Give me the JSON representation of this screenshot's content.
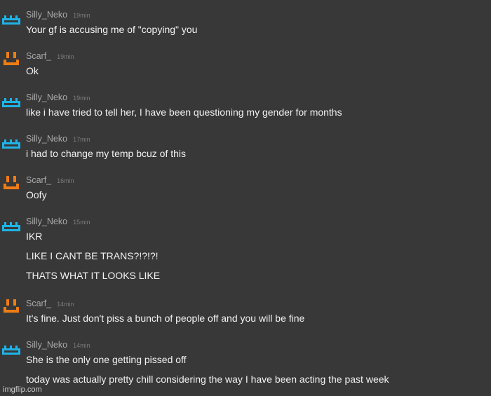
{
  "watermark": "imgflip.com",
  "colors": {
    "background": "#383838",
    "neko": "#1fb4e8",
    "scarf": "#f07d14"
  },
  "messages": [
    {
      "user": "Silly_Neko",
      "avatar": "neko",
      "time": "19min",
      "lines": [
        "Your gf is accusing me of \"copying\" you"
      ]
    },
    {
      "user": "Scarf_",
      "avatar": "scarf",
      "time": "19min",
      "lines": [
        "Ok"
      ]
    },
    {
      "user": "Silly_Neko",
      "avatar": "neko",
      "time": "19min",
      "lines": [
        "like i have tried to tell her, I have been questioning my gender for months"
      ]
    },
    {
      "user": "Silly_Neko",
      "avatar": "neko",
      "time": "17min",
      "lines": [
        "i had to change my temp bcuz of this"
      ]
    },
    {
      "user": "Scarf_",
      "avatar": "scarf",
      "time": "16min",
      "lines": [
        "Oofy"
      ]
    },
    {
      "user": "Silly_Neko",
      "avatar": "neko",
      "time": "15min",
      "lines": [
        "IKR",
        "LIKE I CANT BE TRANS?!?!?!",
        "THATS WHAT IT LOOKS LIKE"
      ]
    },
    {
      "user": "Scarf_",
      "avatar": "scarf",
      "time": "14min",
      "lines": [
        "It's fine. Just don't piss a bunch of people off and you will be fine"
      ]
    },
    {
      "user": "Silly_Neko",
      "avatar": "neko",
      "time": "14min",
      "lines": [
        "She is the only one getting pissed off",
        "today was actually pretty chill considering the way I have been acting the past week"
      ]
    }
  ]
}
